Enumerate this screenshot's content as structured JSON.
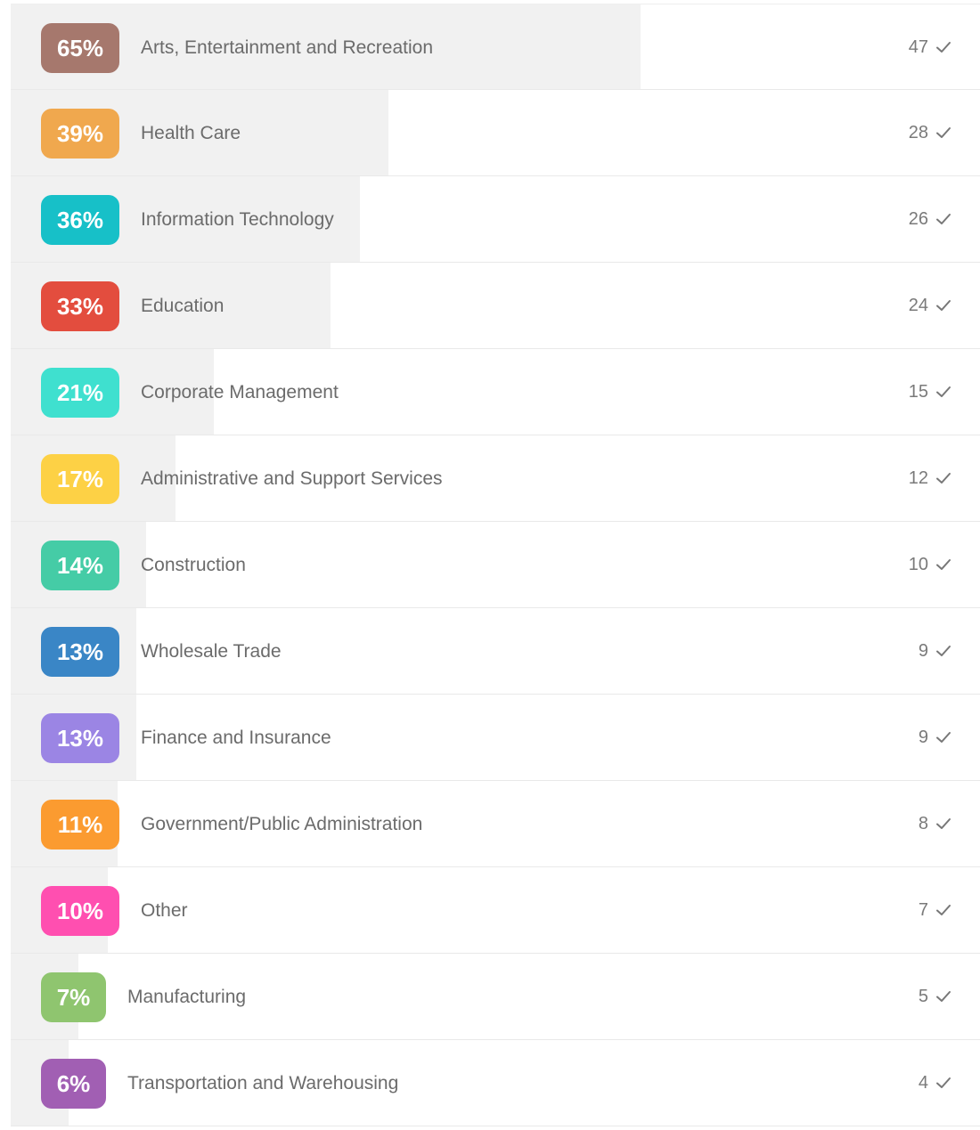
{
  "chart_data": {
    "type": "bar",
    "title": "",
    "xlabel": "",
    "ylabel": "",
    "ylim": [
      0,
      100
    ],
    "categories": [
      "Arts, Entertainment and Recreation",
      "Health Care",
      "Information Technology",
      "Education",
      "Corporate Management",
      "Administrative and Support Services",
      "Construction",
      "Wholesale Trade",
      "Finance and Insurance",
      "Government/Public Administration",
      "Other",
      "Manufacturing",
      "Transportation and Warehousing"
    ],
    "series": [
      {
        "values": [
          65,
          39,
          36,
          33,
          21,
          17,
          14,
          13,
          13,
          11,
          10,
          7,
          6
        ]
      }
    ],
    "percent_labels": [
      "65%",
      "39%",
      "36%",
      "33%",
      "21%",
      "17%",
      "14%",
      "13%",
      "13%",
      "11%",
      "10%",
      "7%",
      "6%"
    ],
    "counts": [
      "47",
      "28",
      "26",
      "24",
      "15",
      "12",
      "10",
      "9",
      "9",
      "8",
      "7",
      "5",
      "4"
    ],
    "badge_colors": [
      "#a6786d",
      "#f0a84e",
      "#17c0c8",
      "#e34d3e",
      "#3fe0cf",
      "#fdd145",
      "#45cca6",
      "#3a86c6",
      "#9b85e4",
      "#fb9b30",
      "#ff4fb0",
      "#8fc56f",
      "#a15fb3"
    ],
    "bar_fill_color": "#f1f1f1",
    "row_icon": "check-icon",
    "grid": false,
    "legend": "none"
  }
}
